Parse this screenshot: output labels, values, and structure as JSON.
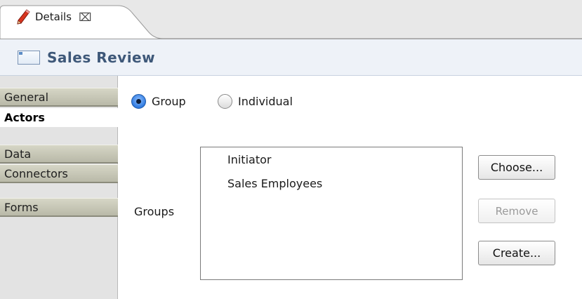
{
  "editor_tab": {
    "label": "Details",
    "close_glyph": "⌧",
    "icon": "pencil-icon"
  },
  "form": {
    "title": "Sales Review",
    "icon": "form-icon"
  },
  "sidebar": {
    "items": [
      {
        "label": "General",
        "active": false
      },
      {
        "label": "Actors",
        "active": true
      },
      {
        "label": "Data",
        "active": false
      },
      {
        "label": "Connectors",
        "active": false
      },
      {
        "label": "Forms",
        "active": false
      }
    ]
  },
  "actor_type": {
    "options": [
      {
        "label": "Group",
        "checked": true
      },
      {
        "label": "Individual",
        "checked": false
      }
    ]
  },
  "groups": {
    "label": "Groups",
    "items": [
      "Initiator",
      "Sales Employees"
    ]
  },
  "buttons": {
    "choose": "Choose...",
    "remove": "Remove",
    "create": "Create...",
    "remove_enabled": false
  },
  "colors": {
    "title_text": "#3e5879",
    "title_bar_bg": "#eef2f8",
    "radio_selected": "#2f7ae0"
  }
}
